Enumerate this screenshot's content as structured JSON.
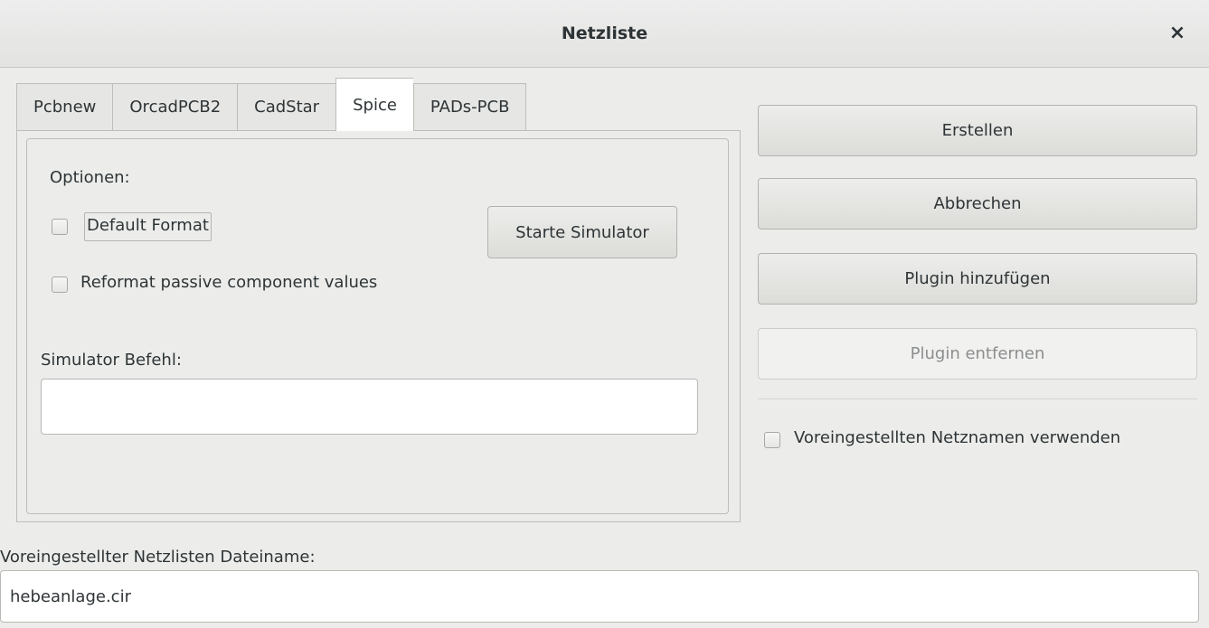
{
  "window": {
    "title": "Netzliste",
    "close_glyph": "×"
  },
  "tabs": [
    {
      "label": "Pcbnew"
    },
    {
      "label": "OrcadPCB2"
    },
    {
      "label": "CadStar"
    },
    {
      "label": "Spice",
      "active": true
    },
    {
      "label": "PADs-PCB"
    }
  ],
  "spice_page": {
    "options_label": "Optionen:",
    "default_format_label": "Default Format",
    "default_format_checked": false,
    "reformat_label": "Reformat passive component values",
    "reformat_checked": false,
    "start_simulator_label": "Starte Simulator",
    "simulator_command_label": "Simulator Befehl:",
    "simulator_command_value": ""
  },
  "actions": {
    "create_label": "Erstellen",
    "cancel_label": "Abbrechen",
    "add_plugin_label": "Plugin hinzufügen",
    "remove_plugin_label": "Plugin entfernen",
    "use_default_netnames_label": "Voreingestellten Netznamen verwenden",
    "use_default_netnames_checked": false
  },
  "filename": {
    "label": "Voreingestellter Netzlisten Dateiname:",
    "value": "hebeanlage.cir"
  },
  "icons": {
    "close": "close-icon"
  }
}
